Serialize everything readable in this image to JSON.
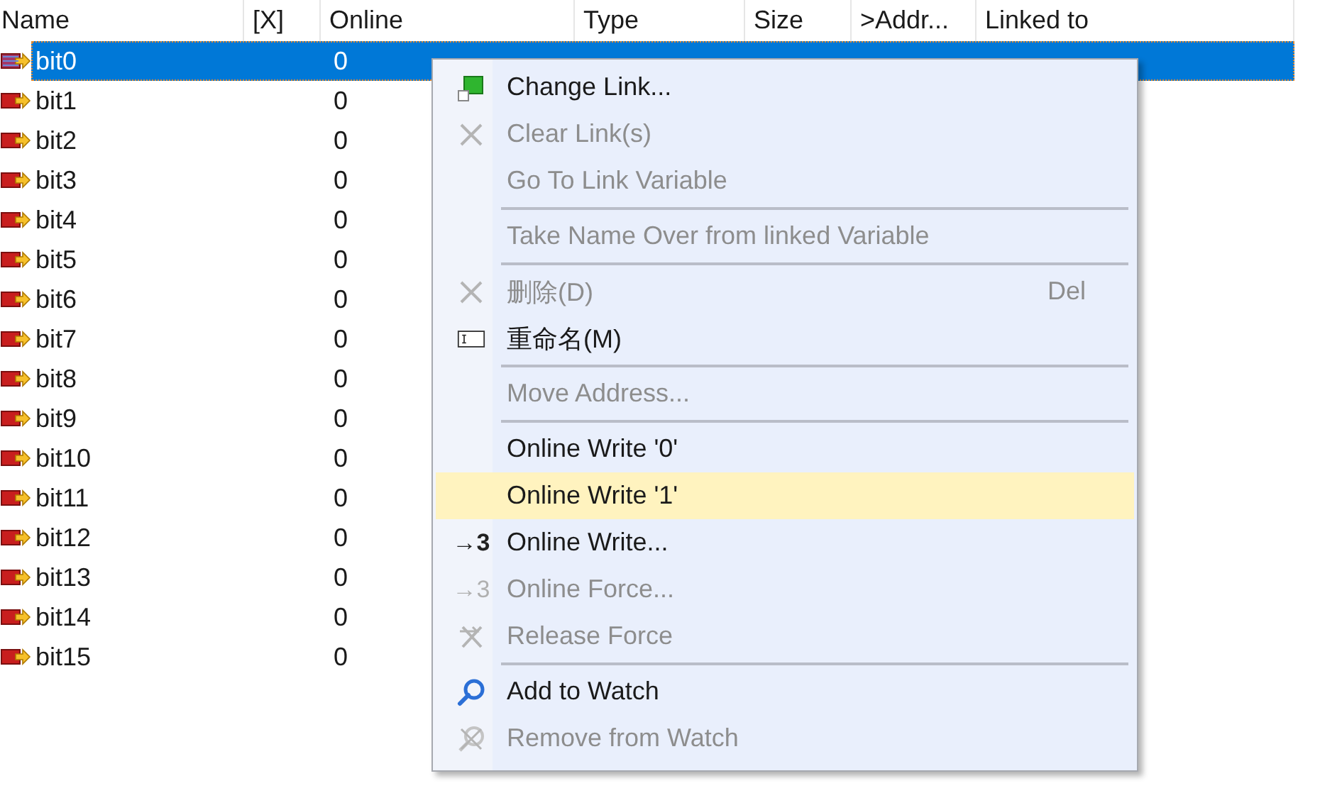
{
  "columns": [
    "Name",
    "[X]",
    "Online",
    "Type",
    "Size",
    ">Addr...",
    "Linked to"
  ],
  "rows": [
    {
      "name": "bit0",
      "online": "0",
      "selected": true
    },
    {
      "name": "bit1",
      "online": "0",
      "selected": false
    },
    {
      "name": "bit2",
      "online": "0",
      "selected": false
    },
    {
      "name": "bit3",
      "online": "0",
      "selected": false
    },
    {
      "name": "bit4",
      "online": "0",
      "selected": false
    },
    {
      "name": "bit5",
      "online": "0",
      "selected": false
    },
    {
      "name": "bit6",
      "online": "0",
      "selected": false
    },
    {
      "name": "bit7",
      "online": "0",
      "selected": false
    },
    {
      "name": "bit8",
      "online": "0",
      "selected": false
    },
    {
      "name": "bit9",
      "online": "0",
      "selected": false
    },
    {
      "name": "bit10",
      "online": "0",
      "selected": false
    },
    {
      "name": "bit11",
      "online": "0",
      "selected": false
    },
    {
      "name": "bit12",
      "online": "0",
      "selected": false
    },
    {
      "name": "bit13",
      "online": "0",
      "selected": false
    },
    {
      "name": "bit14",
      "online": "0",
      "selected": false
    },
    {
      "name": "bit15",
      "online": "0",
      "selected": false
    }
  ],
  "context_menu": [
    {
      "kind": "item",
      "label": "Change Link...",
      "disabled": false,
      "highlighted": false
    },
    {
      "kind": "item",
      "label": "Clear Link(s)",
      "disabled": true,
      "highlighted": false
    },
    {
      "kind": "item",
      "label": "Go To Link Variable",
      "disabled": true,
      "highlighted": false
    },
    {
      "kind": "separator"
    },
    {
      "kind": "item",
      "label": "Take Name Over from linked Variable",
      "disabled": true,
      "highlighted": false
    },
    {
      "kind": "separator"
    },
    {
      "kind": "item",
      "label": "删除(D)",
      "shortcut": "Del",
      "disabled": true,
      "highlighted": false
    },
    {
      "kind": "item",
      "label": "重命名(M)",
      "disabled": false,
      "highlighted": false
    },
    {
      "kind": "separator"
    },
    {
      "kind": "item",
      "label": "Move Address...",
      "disabled": true,
      "highlighted": false
    },
    {
      "kind": "separator"
    },
    {
      "kind": "item",
      "label": "Online Write '0'",
      "disabled": false,
      "highlighted": false
    },
    {
      "kind": "item",
      "label": "Online Write '1'",
      "disabled": false,
      "highlighted": true
    },
    {
      "kind": "item",
      "glyph": "→3",
      "label": "Online Write...",
      "disabled": false,
      "highlighted": false
    },
    {
      "kind": "item",
      "glyph": "→3",
      "label": "Online Force...",
      "disabled": true,
      "highlighted": false
    },
    {
      "kind": "item",
      "label": "Release Force",
      "disabled": true,
      "highlighted": false
    },
    {
      "kind": "separator"
    },
    {
      "kind": "item",
      "label": "Add to Watch",
      "disabled": false,
      "highlighted": false
    },
    {
      "kind": "item",
      "label": "Remove from Watch",
      "disabled": true,
      "highlighted": false
    }
  ]
}
